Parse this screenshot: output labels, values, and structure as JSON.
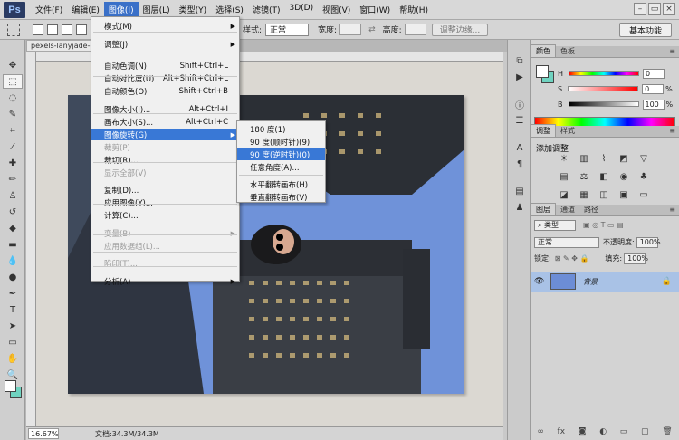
{
  "app": {
    "logo": "Ps"
  },
  "menubar": {
    "items": [
      "文件(F)",
      "编辑(E)",
      "图像(I)",
      "图层(L)",
      "类型(Y)",
      "选择(S)",
      "滤镜(T)",
      "3D(D)",
      "视图(V)",
      "窗口(W)",
      "帮助(H)"
    ],
    "active_index": 2
  },
  "window_controls": {
    "minimize": "–",
    "restore": "▭",
    "close": "×"
  },
  "options": {
    "style_label": "样式:",
    "style_value": "正常",
    "width_label": "宽度:",
    "height_label": "高度:",
    "refine_button": "调整边缘...",
    "workspace": "基本功能"
  },
  "document": {
    "tab_title": "pexels-lanyjade-m",
    "zoom": "16.67%",
    "doc_info": "文档:34.3M/34.3M"
  },
  "image_menu": {
    "items": [
      {
        "label": "模式(M)",
        "shortcut": "",
        "submenu": true,
        "disabled": false
      },
      {
        "label": "调整(J)",
        "shortcut": "",
        "submenu": true,
        "disabled": false
      },
      {
        "label": "自动色调(N)",
        "shortcut": "Shift+Ctrl+L",
        "submenu": false,
        "disabled": false
      },
      {
        "label": "自动对比度(U)",
        "shortcut": "Alt+Shift+Ctrl+L",
        "submenu": false,
        "disabled": false
      },
      {
        "label": "自动颜色(O)",
        "shortcut": "Shift+Ctrl+B",
        "submenu": false,
        "disabled": false
      },
      {
        "label": "图像大小(I)...",
        "shortcut": "Alt+Ctrl+I",
        "submenu": false,
        "disabled": false
      },
      {
        "label": "画布大小(S)...",
        "shortcut": "Alt+Ctrl+C",
        "submenu": false,
        "disabled": false
      },
      {
        "label": "图像旋转(G)",
        "shortcut": "",
        "submenu": true,
        "disabled": false,
        "highlight": true
      },
      {
        "label": "裁剪(P)",
        "shortcut": "",
        "submenu": false,
        "disabled": true
      },
      {
        "label": "裁切(R)...",
        "shortcut": "",
        "submenu": false,
        "disabled": false
      },
      {
        "label": "显示全部(V)",
        "shortcut": "",
        "submenu": false,
        "disabled": true
      },
      {
        "label": "复制(D)...",
        "shortcut": "",
        "submenu": false,
        "disabled": false
      },
      {
        "label": "应用图像(Y)...",
        "shortcut": "",
        "submenu": false,
        "disabled": false
      },
      {
        "label": "计算(C)...",
        "shortcut": "",
        "submenu": false,
        "disabled": false
      },
      {
        "label": "变量(B)",
        "shortcut": "",
        "submenu": true,
        "disabled": true
      },
      {
        "label": "应用数据组(L)...",
        "shortcut": "",
        "submenu": false,
        "disabled": true
      },
      {
        "label": "陷印(T)...",
        "shortcut": "",
        "submenu": false,
        "disabled": true
      },
      {
        "label": "分析(A)",
        "shortcut": "",
        "submenu": true,
        "disabled": false
      }
    ]
  },
  "rotate_submenu": {
    "items": [
      {
        "label": "180 度(1)"
      },
      {
        "label": "90 度(顺时针)(9)"
      },
      {
        "label": "90 度(逆时针)(0)",
        "highlight": true
      },
      {
        "label": "任意角度(A)..."
      },
      {
        "label": "水平翻转画布(H)"
      },
      {
        "label": "垂直翻转画布(V)"
      }
    ]
  },
  "color_panel": {
    "tabs": [
      "颜色",
      "色板"
    ],
    "rows": [
      {
        "label": "H",
        "value": "0"
      },
      {
        "label": "S",
        "value": "0"
      },
      {
        "label": "B",
        "value": "100"
      }
    ],
    "unit": "%"
  },
  "adjust_panel": {
    "tabs": [
      "调整",
      "样式"
    ],
    "title": "添加调整"
  },
  "layers_panel": {
    "tabs": [
      "图层",
      "通道",
      "路径"
    ],
    "filter": "类型",
    "blend_mode": "正常",
    "opacity_label": "不透明度:",
    "opacity_value": "100%",
    "lock_label": "锁定:",
    "fill_label": "填充:",
    "fill_value": "100%",
    "layer_name": "背景"
  },
  "colors": {
    "accent": "#3978d6",
    "background_swatch": "#6fd3c0"
  }
}
